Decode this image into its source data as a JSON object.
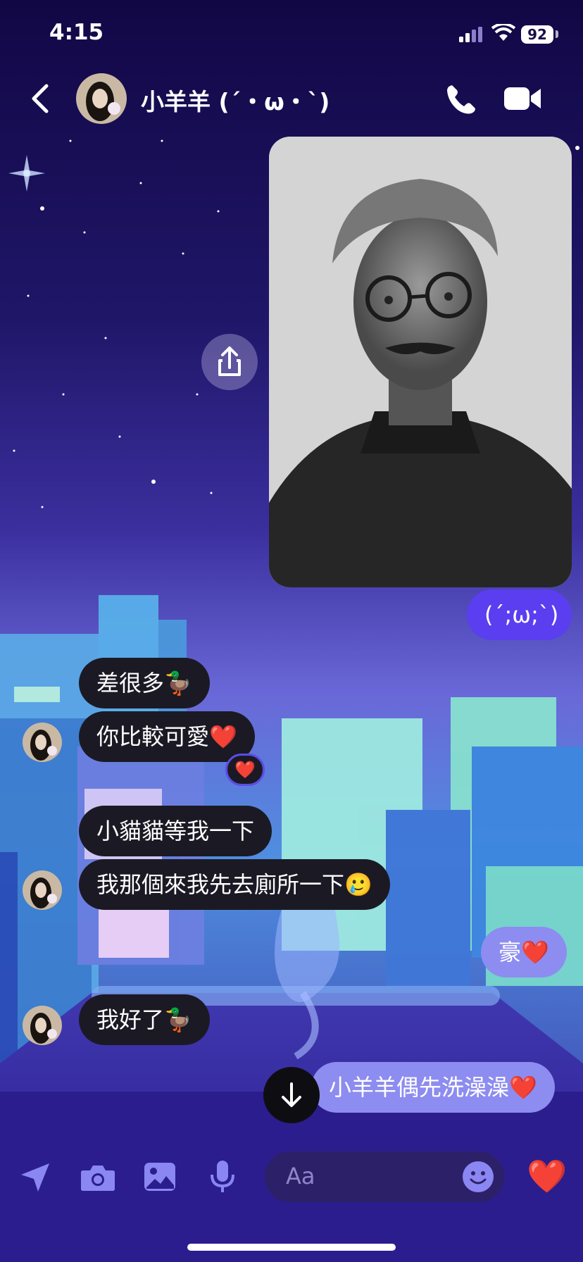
{
  "status_bar": {
    "time": "4:15",
    "battery": "92"
  },
  "header": {
    "contact_name": "小羊羊 (´・ω・`)"
  },
  "messages": {
    "m1": "(´;ω;`)",
    "m2": "差很多🦆",
    "m3": "你比較可愛❤️",
    "m3_reaction": "❤️",
    "m4": "小貓貓等我一下",
    "m5": "我那個來我先去廁所一下🥲",
    "m6": "豪❤️",
    "m7": "我好了🦆",
    "m8": "小羊羊偶先洗澡澡❤️"
  },
  "composer": {
    "placeholder": "Aa",
    "like": "❤️"
  },
  "icons": [
    "back-icon",
    "phone-icon",
    "video-icon",
    "share-icon",
    "arrow-down-icon",
    "location-icon",
    "camera-icon",
    "gallery-icon",
    "mic-icon",
    "emoji-icon"
  ],
  "colors": {
    "outgoing_bubble": "#5a3ef0",
    "incoming_bubble": "#1b1a24",
    "accent": "#8d8cf0"
  }
}
